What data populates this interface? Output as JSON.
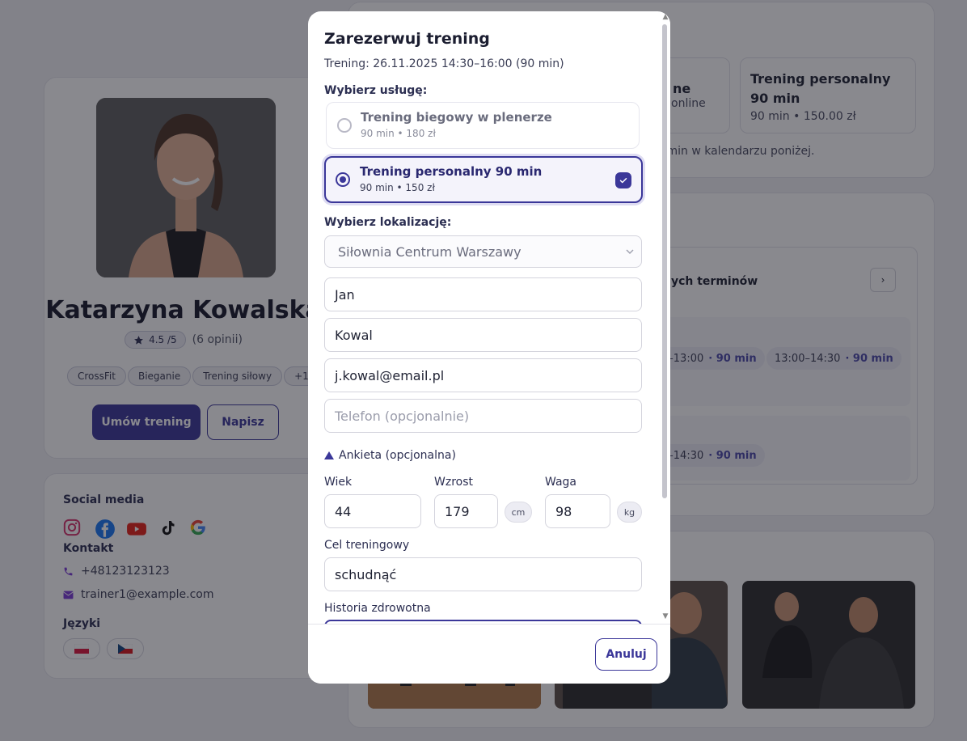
{
  "profile": {
    "name": "Katarzyna Kowalska",
    "rating": "4.5 /5",
    "reviews": "(6 opinii)",
    "tags": [
      "CrossFit",
      "Bieganie",
      "Trening siłowy",
      "+1"
    ],
    "book_button": "Umów trening",
    "message_button": "Napisz"
  },
  "contact": {
    "social_label": "Social media",
    "contact_label": "Kontakt",
    "phone": "+48123123123",
    "email": "trainer1@example.com",
    "languages_label": "Języki"
  },
  "services_bg": {
    "tile1_title": "ne",
    "tile1_sub": "online",
    "tile2_title": "Trening personalny 90 min",
    "tile2_sub": "90 min • 150.00 zł",
    "hint": "rmin w kalendarzu poniżej."
  },
  "calendar_bg": {
    "title": "nych terminów",
    "next": "›",
    "slots_row1": [
      {
        "time": "0–13:00",
        "duration": "· 90 min"
      },
      {
        "time": "13:00–14:30",
        "duration": "· 90 min"
      }
    ],
    "slots_row2": [
      {
        "time": "0–14:30",
        "duration": "· 90 min"
      }
    ]
  },
  "modal": {
    "title": "Zarezerwuj trening",
    "subtitle": "Trening: 26.11.2025 14:30–16:00 (90 min)",
    "service_label": "Wybierz usługę:",
    "options": [
      {
        "title": "Trening biegowy w plenerze",
        "sub": "90 min • 180 zł"
      },
      {
        "title": "Trening personalny 90 min",
        "sub": "90 min • 150 zł"
      }
    ],
    "location_label": "Wybierz lokalizację:",
    "location_value": "Siłownia Centrum Warszawy",
    "first_name": "Jan",
    "last_name": "Kowal",
    "email": "j.kowal@email.pl",
    "phone_placeholder": "Telefon (opcjonalnie)",
    "survey_toggle": "Ankieta (opcjonalna)",
    "age_label": "Wiek",
    "age_value": "44",
    "height_label": "Wzrost",
    "height_value": "179",
    "height_unit": "cm",
    "weight_label": "Waga",
    "weight_value": "98",
    "weight_unit": "kg",
    "goal_label": "Cel treningowy",
    "goal_value": "schudnąć",
    "health_label": "Historia zdrowotna",
    "cancel_button": "Anuluj"
  },
  "colors": {
    "accent": "#3b3799",
    "overlay": "rgba(20,20,30,0.5)"
  }
}
